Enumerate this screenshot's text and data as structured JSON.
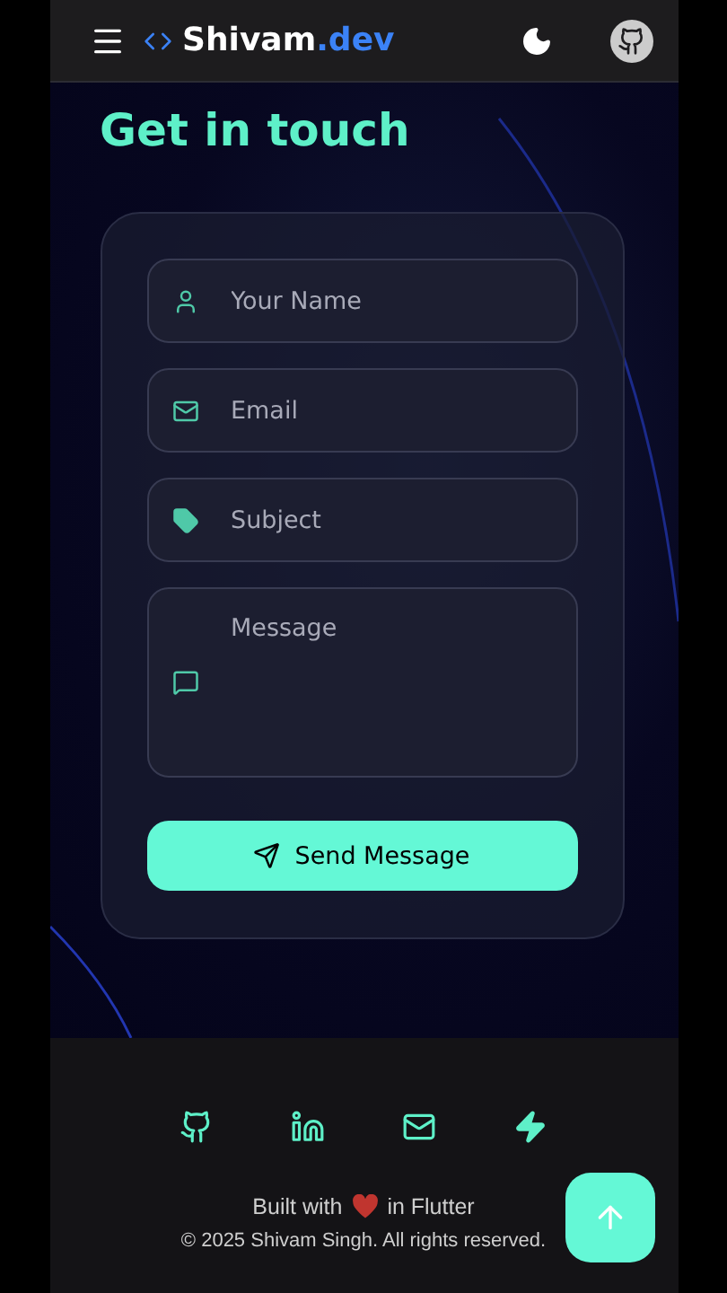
{
  "header": {
    "logo": {
      "name": "Shivam",
      "suffix": ".dev"
    }
  },
  "contact": {
    "title": "Get in touch",
    "fields": [
      {
        "kind": "name",
        "placeholder": "Your Name"
      },
      {
        "kind": "email",
        "placeholder": "Email"
      },
      {
        "kind": "subject",
        "placeholder": "Subject"
      },
      {
        "kind": "message",
        "placeholder": "Message"
      }
    ],
    "submit": "Send Message"
  },
  "footer": {
    "socials": [
      {
        "kind": "github"
      },
      {
        "kind": "linkedin"
      },
      {
        "kind": "email"
      },
      {
        "kind": "bolt"
      }
    ],
    "built_with": {
      "before": "Built with",
      "after": "in Flutter"
    },
    "copyright": "© 2025 Shivam Singh. All rights reserved."
  }
}
